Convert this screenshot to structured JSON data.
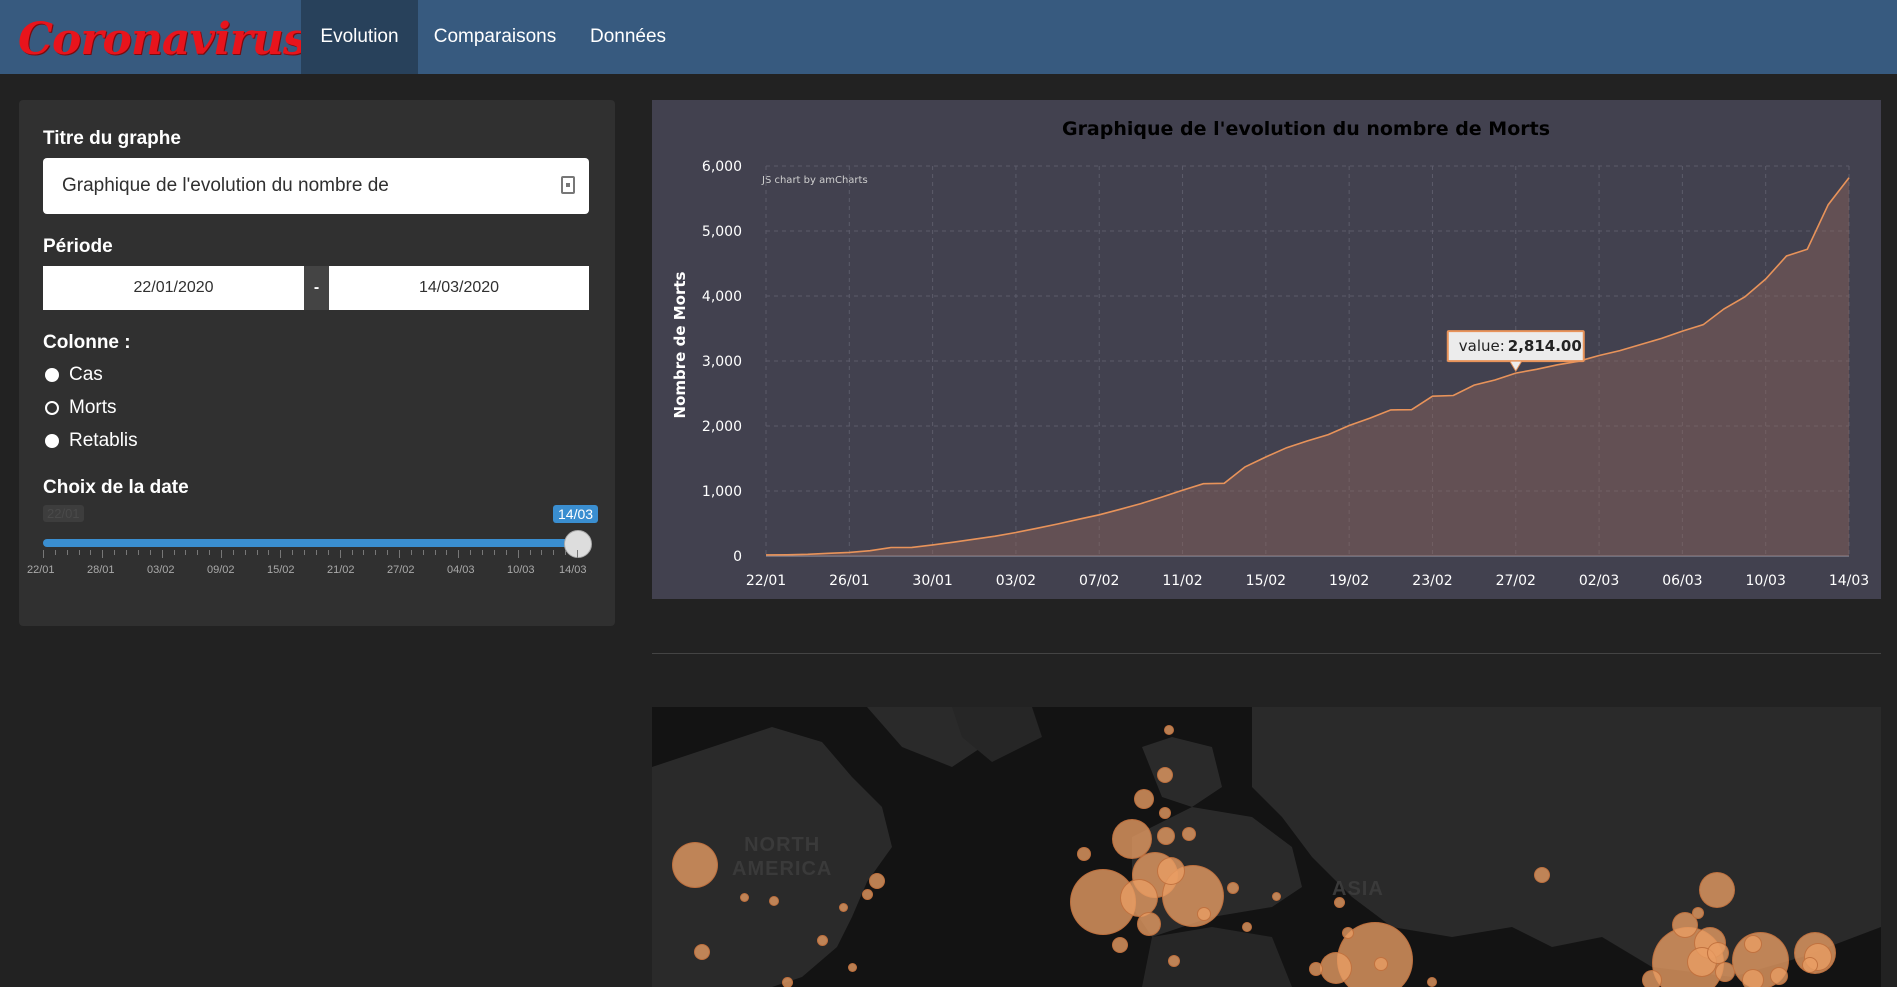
{
  "navbar": {
    "brand": "Coronavirus",
    "tabs": [
      {
        "label": "Evolution",
        "active": true
      },
      {
        "label": "Comparaisons",
        "active": false
      },
      {
        "label": "Données",
        "active": false
      }
    ],
    "bg_color": "#375a7f",
    "active_color": "#28415b"
  },
  "sidebar": {
    "title_label": "Titre du graphe",
    "title_value": "Graphique de l'evolution du nombre de",
    "title_icon": "contact-card-icon",
    "period_label": "Période",
    "period_start": "22/01/2020",
    "period_separator": "-",
    "period_end": "14/03/2020",
    "column_label": "Colonne :",
    "column_options": [
      {
        "label": "Cas",
        "selected": false
      },
      {
        "label": "Morts",
        "selected": true
      },
      {
        "label": "Retablis",
        "selected": false
      }
    ],
    "date_label": "Choix de la date",
    "slider_min_label": "22/01",
    "slider_value": "14/03",
    "slider_ticks": [
      "22/01",
      "28/01",
      "03/02",
      "09/02",
      "15/02",
      "21/02",
      "27/02",
      "04/03",
      "10/03",
      "14/03"
    ]
  },
  "chart_data": {
    "type": "area",
    "title": "Graphique de l'evolution du nombre de Morts",
    "credit": "JS chart by amCharts",
    "ylabel": "Nombre de Morts",
    "xlabel": "",
    "ylim": [
      0,
      6000
    ],
    "y_ticks": [
      "0",
      "1,000",
      "2,000",
      "3,000",
      "4,000",
      "5,000",
      "6,000"
    ],
    "x_tick_labels": [
      "22/01",
      "26/01",
      "30/01",
      "03/02",
      "07/02",
      "11/02",
      "15/02",
      "19/02",
      "23/02",
      "27/02",
      "02/03",
      "06/03",
      "10/03",
      "14/03"
    ],
    "grid": true,
    "line_color": "#e8935a",
    "tooltip": {
      "label": "value:",
      "value": "2,814.00",
      "index": 36
    },
    "values": [
      17,
      18,
      26,
      42,
      56,
      82,
      131,
      133,
      171,
      213,
      259,
      305,
      362,
      426,
      492,
      564,
      634,
      719,
      806,
      906,
      1013,
      1113,
      1118,
      1371,
      1523,
      1666,
      1770,
      1868,
      2007,
      2122,
      2247,
      2251,
      2458,
      2469,
      2629,
      2708,
      2814,
      2872,
      2941,
      2996,
      3085,
      3160,
      3254,
      3348,
      3460,
      3558,
      3802,
      3988,
      4262,
      4615,
      4720,
      5404,
      5819
    ]
  },
  "map": {
    "labels": [
      "NORTH\nAMERICA",
      "ASIA"
    ]
  }
}
